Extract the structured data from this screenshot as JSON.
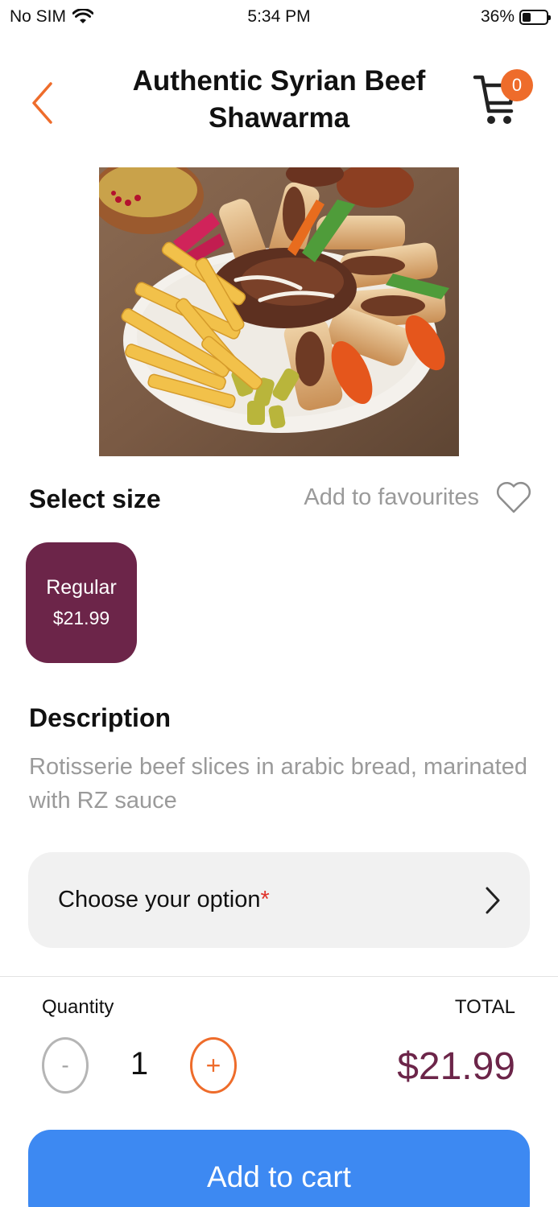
{
  "status_bar": {
    "carrier": "No SIM",
    "time": "5:34 PM",
    "battery_percent": "36%",
    "battery_level": 0.36
  },
  "header": {
    "title": "Authentic Syrian Beef Shawarma",
    "cart_count": "0",
    "back_icon": "chevron-left-icon",
    "cart_icon": "shopping-cart-icon"
  },
  "product": {
    "image_subject": "food-photo"
  },
  "size_section": {
    "title": "Select size",
    "favourites_label": "Add to favourites",
    "sizes": [
      {
        "name": "Regular",
        "price": "$21.99",
        "selected": true
      }
    ]
  },
  "description": {
    "title": "Description",
    "text": "Rotisserie beef slices in arabic bread, marinated with RZ sauce"
  },
  "option": {
    "label": "Choose your option",
    "required_mark": "*"
  },
  "order": {
    "quantity_label": "Quantity",
    "total_label": "TOTAL",
    "minus_label": "-",
    "plus_label": "+",
    "quantity": "1",
    "total": "$21.99",
    "add_to_cart_label": "Add to cart"
  },
  "colors": {
    "accent_orange": "#ee6c2b",
    "brand_plum": "#6c2549",
    "button_blue": "#3d89f2",
    "muted_text": "#9a9a9a",
    "option_bg": "#f1f1f1"
  }
}
